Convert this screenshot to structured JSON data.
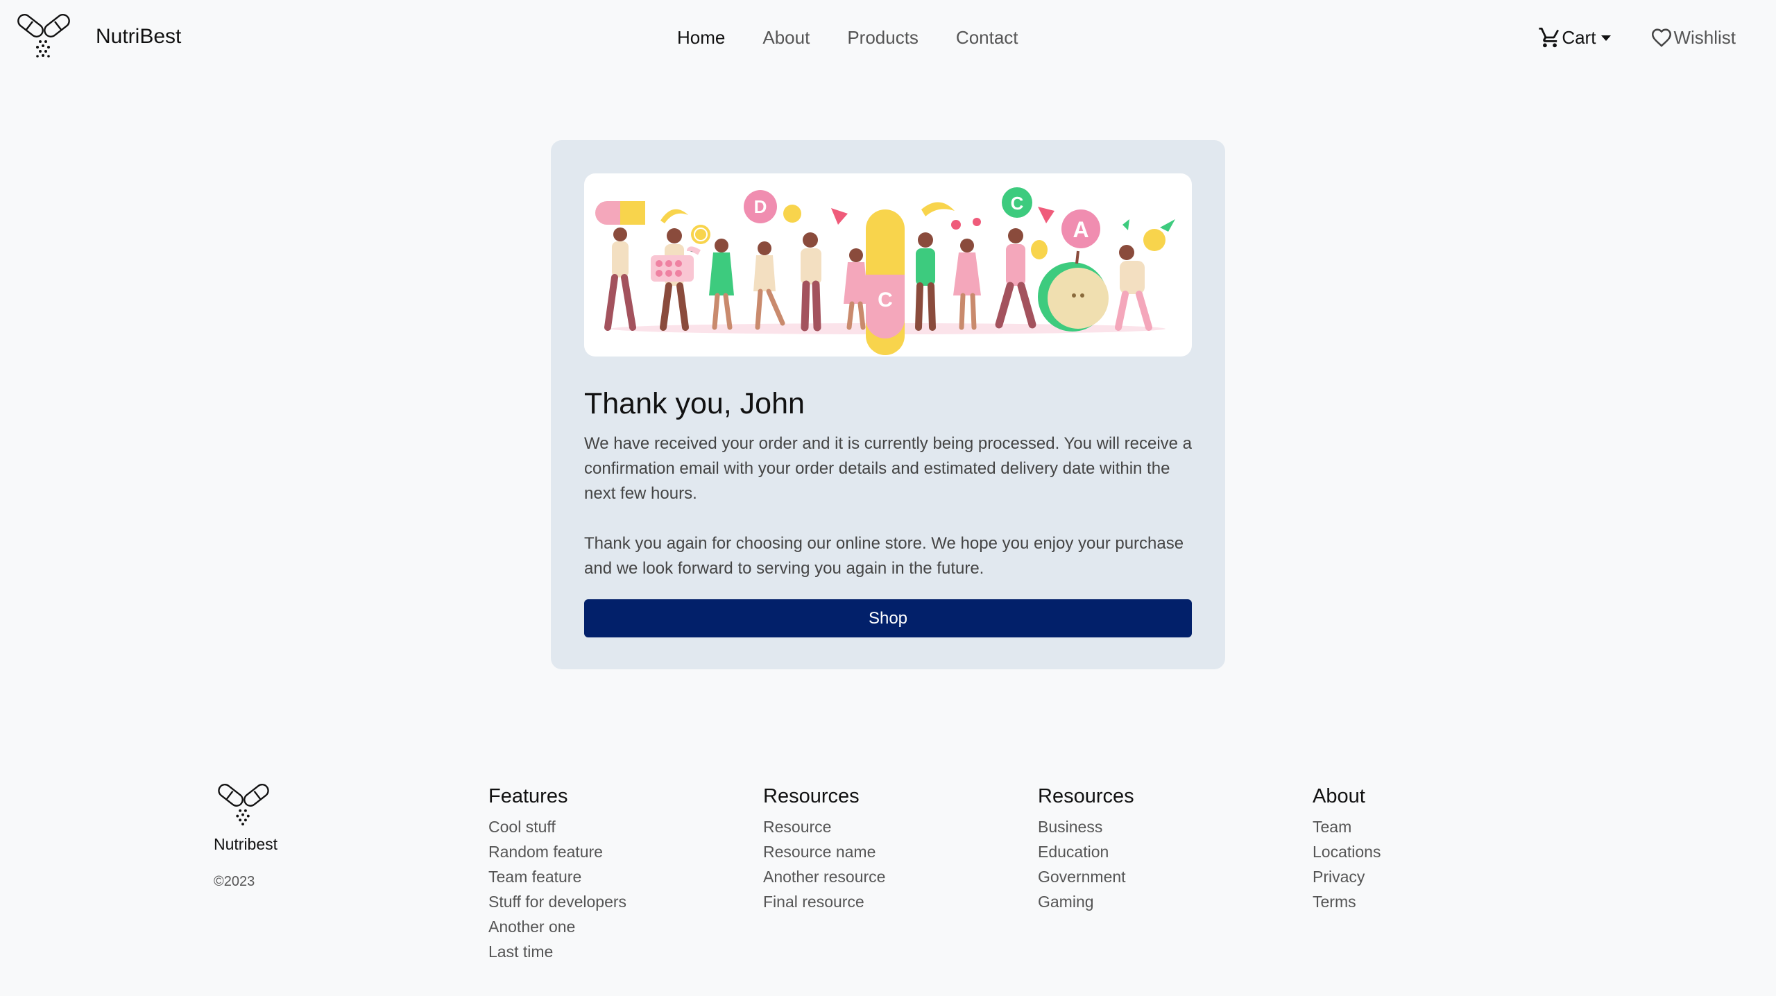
{
  "navbar": {
    "brand": "NutriBest",
    "links": [
      "Home",
      "About",
      "Products",
      "Contact"
    ],
    "cart_label": "Cart",
    "wishlist_label": "Wishlist"
  },
  "card": {
    "title": "Thank you, John",
    "paragraph1": "We have received your order and it is currently being processed. You will receive a confirmation email with your order details and estimated delivery date within the next few hours.",
    "paragraph2": "Thank you again for choosing our online store. We hope you enjoy your purchase and we look forward to serving you again in the future.",
    "button_label": "Shop",
    "illustration_letters": [
      "D",
      "C",
      "C",
      "A"
    ]
  },
  "footer": {
    "brand": "Nutribest",
    "copyright": "©2023",
    "columns": [
      {
        "title": "Features",
        "items": [
          "Cool stuff",
          "Random feature",
          "Team feature",
          "Stuff for developers",
          "Another one",
          "Last time"
        ]
      },
      {
        "title": "Resources",
        "items": [
          "Resource",
          "Resource name",
          "Another resource",
          "Final resource"
        ]
      },
      {
        "title": "Resources",
        "items": [
          "Business",
          "Education",
          "Government",
          "Gaming"
        ]
      },
      {
        "title": "About",
        "items": [
          "Team",
          "Locations",
          "Privacy",
          "Terms"
        ]
      }
    ]
  },
  "colors": {
    "page_bg": "#f8f9fa",
    "card_bg": "#e1e8ef",
    "primary_button": "#02206a"
  },
  "icons": [
    "pill-logo-icon",
    "cart-icon",
    "caret-down-icon",
    "heart-icon"
  ]
}
